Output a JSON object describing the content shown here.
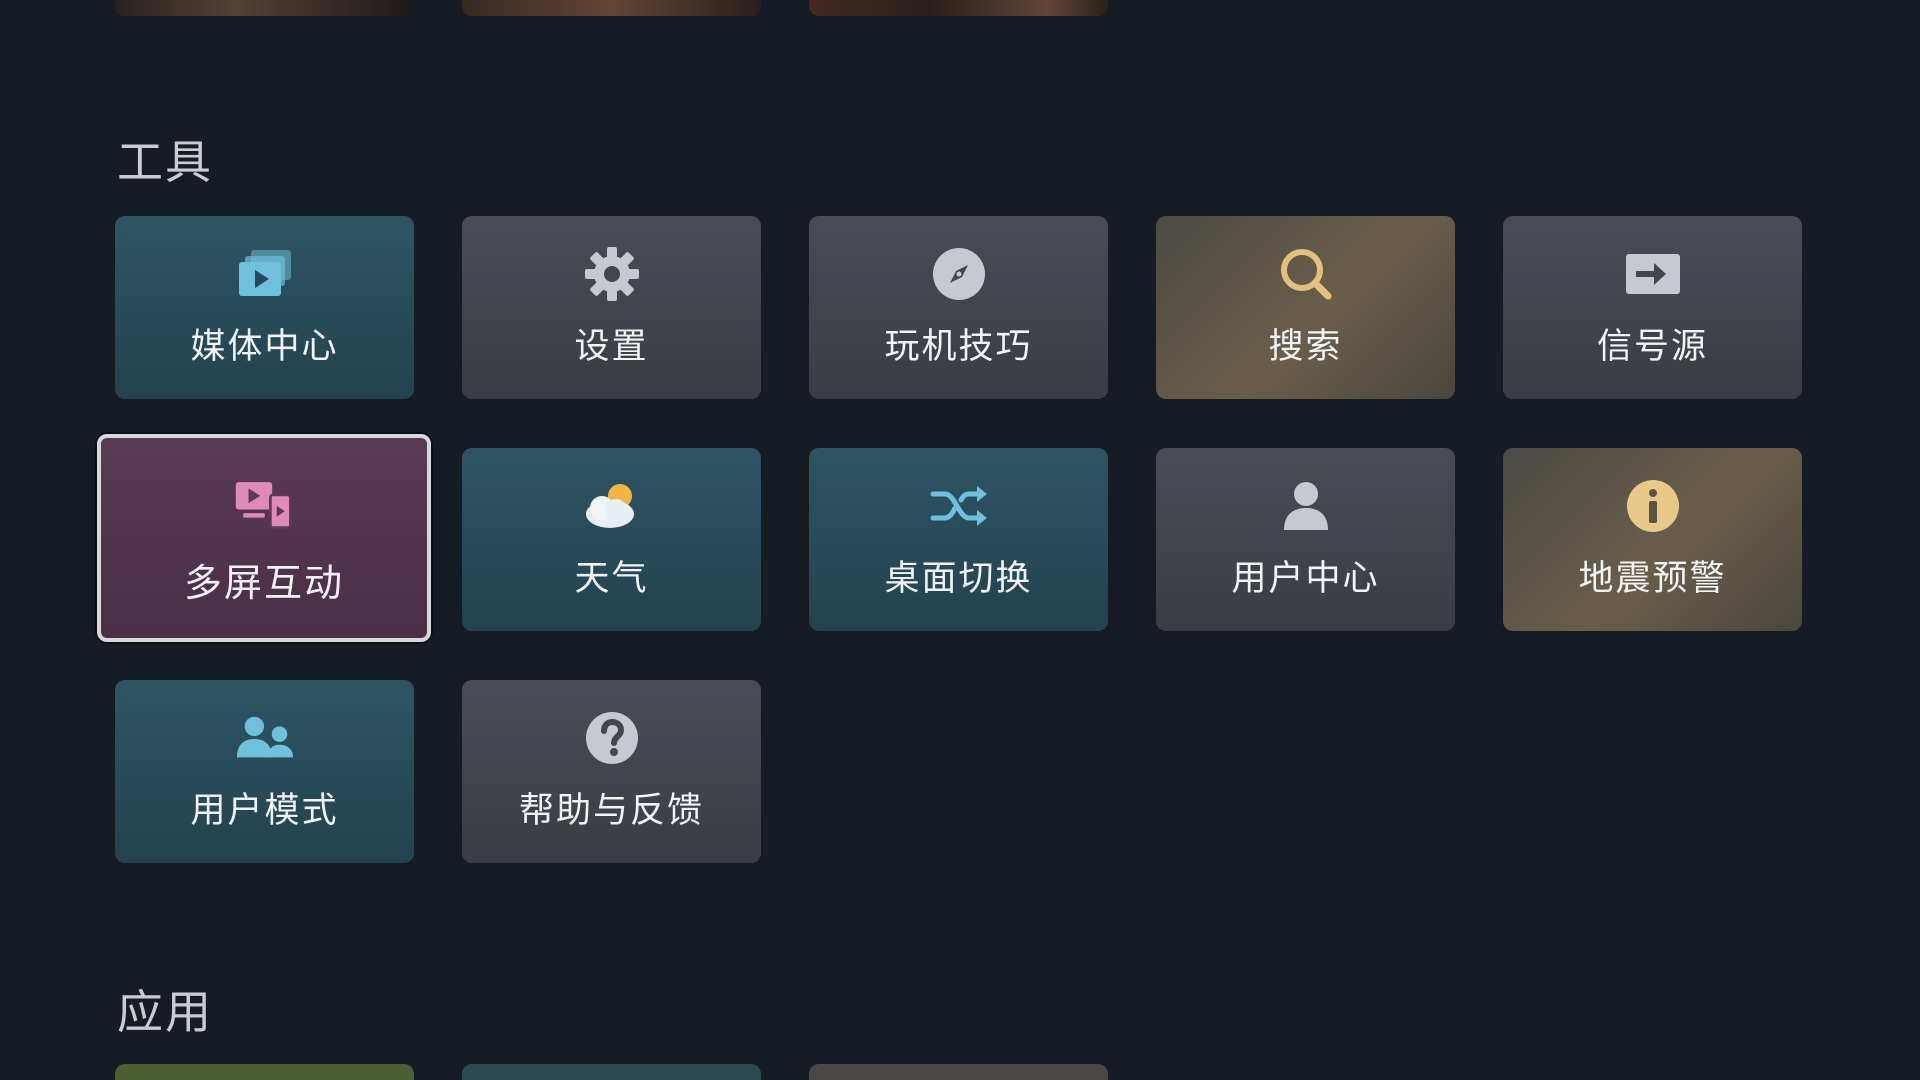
{
  "sections": {
    "tools_title": "工具",
    "apps_title": "应用"
  },
  "tools": [
    {
      "label": "媒体中心",
      "icon": "media-center-icon",
      "color": "#2e5464"
    },
    {
      "label": "设置",
      "icon": "gear-icon",
      "color": "#4a4c55"
    },
    {
      "label": "玩机技巧",
      "icon": "compass-icon",
      "color": "#4a4c55"
    },
    {
      "label": "搜索",
      "icon": "search-icon",
      "color": "#6a5e4a"
    },
    {
      "label": "信号源",
      "icon": "input-source-icon",
      "color": "#4a4c55"
    },
    {
      "label": "多屏互动",
      "icon": "multi-screen-icon",
      "color": "#5a3a55",
      "focused": true
    },
    {
      "label": "天气",
      "icon": "weather-icon",
      "color": "#2e5464"
    },
    {
      "label": "桌面切换",
      "icon": "shuffle-icon",
      "color": "#2e5464"
    },
    {
      "label": "用户中心",
      "icon": "user-icon",
      "color": "#4a4c55"
    },
    {
      "label": "地震预警",
      "icon": "info-icon",
      "color": "#6a5e4a"
    },
    {
      "label": "用户模式",
      "icon": "users-icon",
      "color": "#2e5464"
    },
    {
      "label": "帮助与反馈",
      "icon": "help-icon",
      "color": "#4a4c55"
    }
  ]
}
